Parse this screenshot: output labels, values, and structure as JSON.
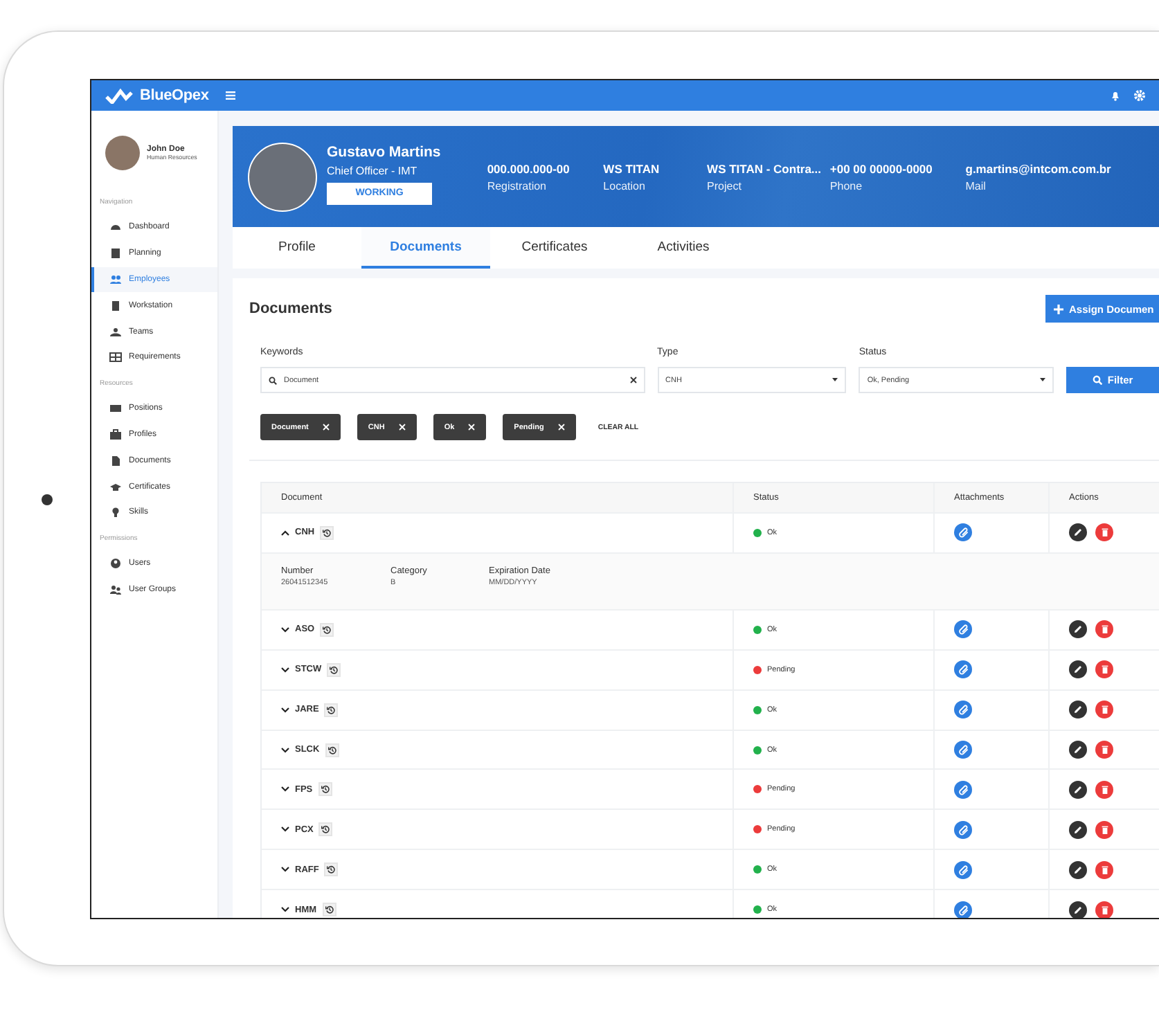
{
  "app": {
    "logo": "BlueOpex"
  },
  "sidebar": {
    "user": {
      "name": "John Doe",
      "role": "Human Resources"
    },
    "sections": [
      {
        "title": "Navigation",
        "items": [
          {
            "label": "Dashboard",
            "selected": false
          },
          {
            "label": "Planning",
            "selected": false
          },
          {
            "label": "Employees",
            "selected": true
          },
          {
            "label": "Workstation",
            "selected": false
          },
          {
            "label": "Teams",
            "selected": false
          },
          {
            "label": "Requirements",
            "selected": false
          }
        ]
      },
      {
        "title": "Resources",
        "items": [
          {
            "label": "Positions",
            "selected": false
          },
          {
            "label": "Profiles",
            "selected": false
          },
          {
            "label": "Documents",
            "selected": false
          },
          {
            "label": "Certificates",
            "selected": false
          },
          {
            "label": "Skills",
            "selected": false
          }
        ]
      },
      {
        "title": "Permissions",
        "items": [
          {
            "label": "Users",
            "selected": false
          },
          {
            "label": "User Groups",
            "selected": false
          }
        ]
      }
    ]
  },
  "profile": {
    "name": "Gustavo Martins",
    "title": "Chief Officer - IMT",
    "status": "WORKING",
    "fields": [
      {
        "value": "000.000.000-00",
        "label": "Registration"
      },
      {
        "value": "WS TITAN",
        "label": "Location"
      },
      {
        "value": "WS TITAN - Contra...",
        "label": "Project"
      },
      {
        "value": "+00 00 00000-0000",
        "label": "Phone"
      },
      {
        "value": "g.martins@intcom.com.br",
        "label": "Mail"
      }
    ]
  },
  "tabs": [
    {
      "label": "Profile",
      "selected": false
    },
    {
      "label": "Documents",
      "selected": true
    },
    {
      "label": "Certificates",
      "selected": false
    },
    {
      "label": "Activities",
      "selected": false
    }
  ],
  "documents": {
    "title": "Documents",
    "assign_button": "Assign Documen",
    "filters": {
      "keywords": {
        "label": "Keywords",
        "value": "Document"
      },
      "type": {
        "label": "Type",
        "value": "CNH"
      },
      "status": {
        "label": "Status",
        "value": "Ok, Pending"
      },
      "filter_button": "Filter"
    },
    "chips": [
      "Document",
      "CNH",
      "Ok",
      "Pending"
    ],
    "clear_all": "CLEAR ALL",
    "table": {
      "columns": [
        "Document",
        "Status",
        "Attachments",
        "Actions"
      ],
      "rows": [
        {
          "document": "CNH",
          "expanded": true,
          "status": "Ok",
          "color": "#22b14c",
          "details": [
            {
              "label": "Number",
              "value": "26041512345"
            },
            {
              "label": "Category",
              "value": "B"
            },
            {
              "label": "Expiration Date",
              "value": "MM/DD/YYYY"
            }
          ]
        },
        {
          "document": "ASO",
          "expanded": false,
          "status": "Ok",
          "color": "#22b14c"
        },
        {
          "document": "STCW",
          "expanded": false,
          "status": "Pending",
          "color": "#ec3b3b"
        },
        {
          "document": "JARE",
          "expanded": false,
          "status": "Ok",
          "color": "#22b14c"
        },
        {
          "document": "SLCK",
          "expanded": false,
          "status": "Ok",
          "color": "#22b14c"
        },
        {
          "document": "FPS",
          "expanded": false,
          "status": "Pending",
          "color": "#ec3b3b"
        },
        {
          "document": "PCX",
          "expanded": false,
          "status": "Pending",
          "color": "#ec3b3b"
        },
        {
          "document": "RAFF",
          "expanded": false,
          "status": "Ok",
          "color": "#22b14c"
        },
        {
          "document": "HMM",
          "expanded": false,
          "status": "Ok",
          "color": "#22b14c"
        }
      ]
    }
  }
}
